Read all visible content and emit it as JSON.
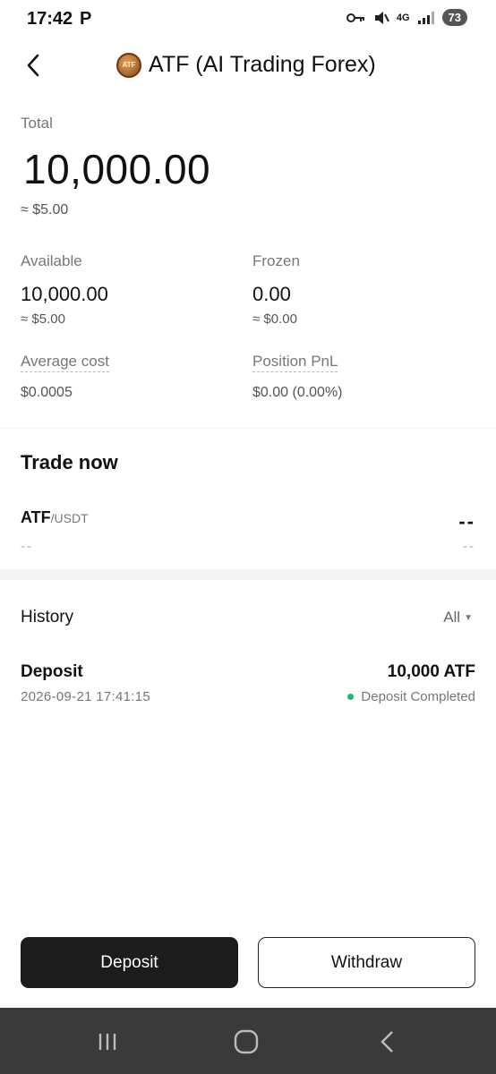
{
  "status_bar": {
    "time": "17:42",
    "app_glyph": "P",
    "network": "4G",
    "battery": "73",
    "icons": [
      "key-icon",
      "mute-icon",
      "signal-icon"
    ]
  },
  "header": {
    "back_icon": "chevron-left-icon",
    "coin_badge": "ATF",
    "title": "ATF (AI Trading Forex)"
  },
  "balance": {
    "total_label": "Total",
    "total_value": "10,000.00",
    "total_usd": "≈ $5.00"
  },
  "stats": {
    "available_label": "Available",
    "available_value": "10,000.00",
    "available_usd": "≈ $5.00",
    "frozen_label": "Frozen",
    "frozen_value": "0.00",
    "frozen_usd": "≈ $0.00",
    "avg_cost_label": "Average cost",
    "avg_cost_value": "$0.0005",
    "pnl_label": "Position PnL",
    "pnl_value": "$0.00 (0.00%)"
  },
  "trade": {
    "title": "Trade now",
    "pair_base": "ATF",
    "pair_quote": "/USDT",
    "price": "--",
    "sub_left": "--",
    "sub_right": "--"
  },
  "history": {
    "title": "History",
    "filter": "All",
    "items": [
      {
        "type": "Deposit",
        "amount": "10,000 ATF",
        "time": "2026-09-21 17:41:15",
        "status": "Deposit Completed",
        "status_color": "#22b573"
      }
    ]
  },
  "actions": {
    "deposit_label": "Deposit",
    "withdraw_label": "Withdraw"
  },
  "nav": {
    "icons": [
      "recent-apps-icon",
      "home-icon",
      "back-icon"
    ]
  },
  "colors": {
    "primary_button": "#1c1c1c",
    "success": "#22b573"
  }
}
